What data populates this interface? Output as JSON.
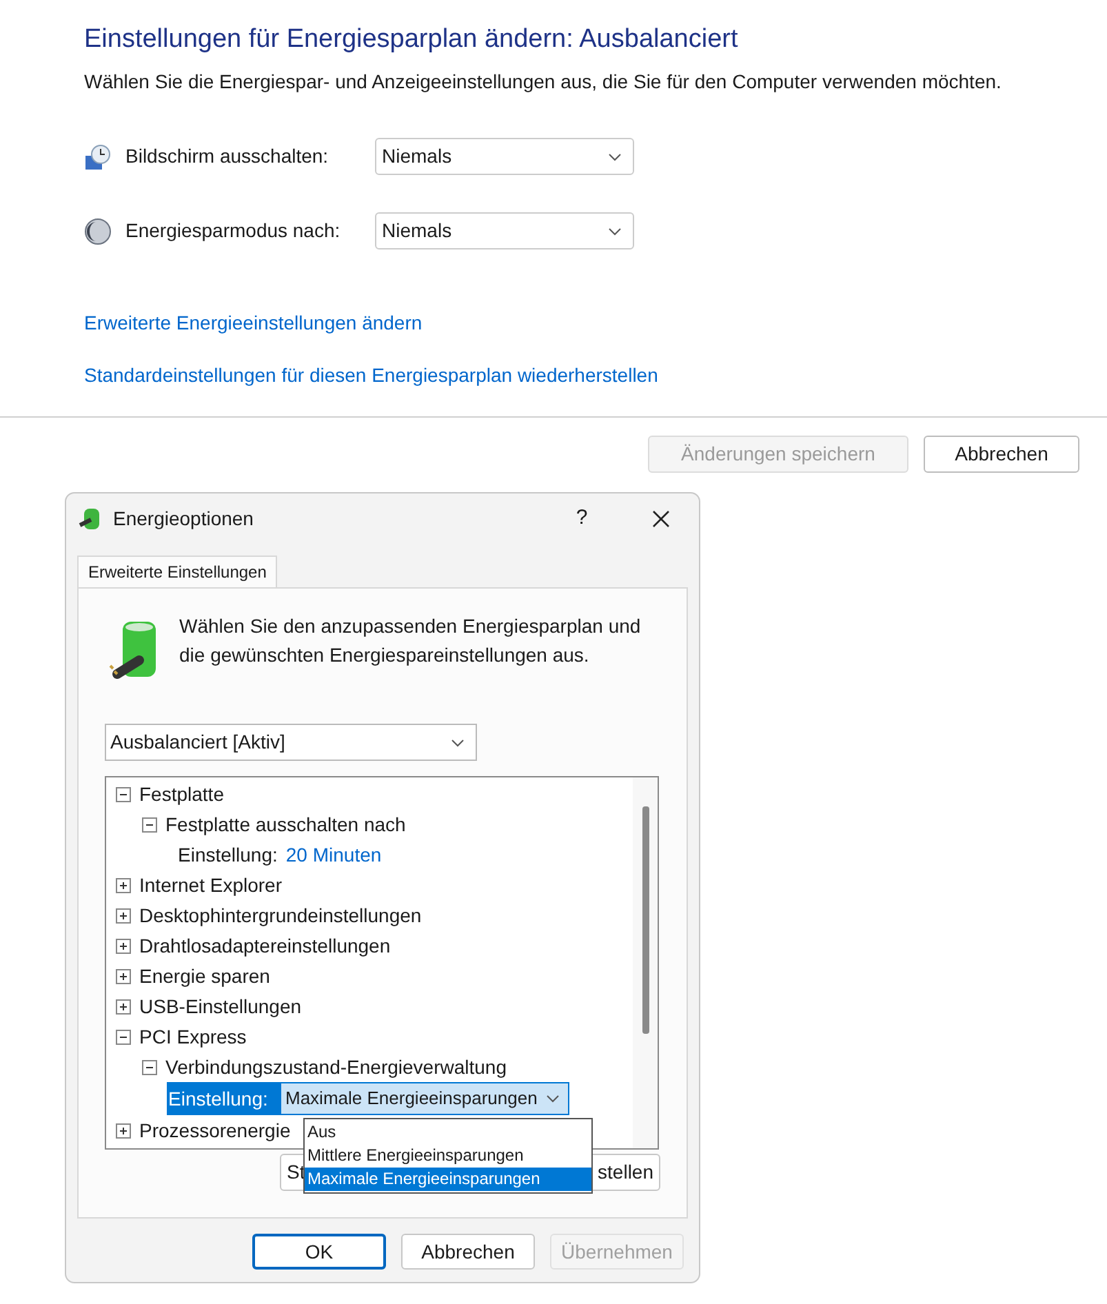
{
  "page": {
    "title": "Einstellungen für Energiesparplan ändern: Ausbalanciert",
    "description": "Wählen Sie die Energiespar- und Anzeigeeinstellungen aus, die Sie für den Computer verwenden möchten.",
    "settings": [
      {
        "kind": "display",
        "label": "Bildschirm ausschalten:",
        "value": "Niemals"
      },
      {
        "kind": "sleep",
        "label": "Energiesparmodus nach:",
        "value": "Niemals"
      }
    ],
    "links": [
      "Erweiterte Energieeinstellungen ändern",
      "Standardeinstellungen für diesen Energiesparplan wiederherstellen"
    ],
    "buttons": [
      {
        "label": "Änderungen speichern",
        "disabled": true
      },
      {
        "label": "Abbrechen",
        "disabled": false
      }
    ]
  },
  "dialog": {
    "title": "Energieoptionen",
    "help": "?",
    "tabs": [
      {
        "label": "Erweiterte Einstellungen",
        "selected": true
      }
    ],
    "intro": "Wählen Sie den anzupassenden Energiesparplan und die gewünschten Energiespareinstellungen aus.",
    "plan": "Ausbalanciert [Aktiv]",
    "tree": [
      {
        "kind": "node",
        "label": "Festplatte",
        "expanded": true,
        "children": [
          {
            "kind": "node",
            "label": "Festplatte ausschalten nach",
            "expanded": true,
            "children": [
              {
                "kind": "setting",
                "label": "Einstellung:",
                "value": "20 Minuten",
                "selected": false
              }
            ]
          }
        ]
      },
      {
        "kind": "node",
        "label": "Internet Explorer",
        "expanded": false
      },
      {
        "kind": "node",
        "label": "Desktophintergrundeinstellungen",
        "expanded": false
      },
      {
        "kind": "node",
        "label": "Drahtlosadaptereinstellungen",
        "expanded": false
      },
      {
        "kind": "node",
        "label": "Energie sparen",
        "expanded": false
      },
      {
        "kind": "node",
        "label": "USB-Einstellungen",
        "expanded": false
      },
      {
        "kind": "node",
        "label": "PCI Express",
        "expanded": true,
        "children": [
          {
            "kind": "node",
            "label": "Verbindungszustand-Energieverwaltung",
            "expanded": true,
            "children": [
              {
                "kind": "combo",
                "label": "Einstellung:",
                "value": "Maximale Energieeinsparungen",
                "selected": true
              }
            ]
          }
        ]
      },
      {
        "kind": "node",
        "label": "Prozessorenergie",
        "expanded": false
      }
    ],
    "options": [
      {
        "label": "Aus",
        "selected": false
      },
      {
        "label": "Mittlere Energieeinsparungen",
        "selected": false
      },
      {
        "label": "Maximale Energieeinsparungen",
        "selected": true
      }
    ],
    "restore_button": {
      "label_start": "St",
      "label_end": "stellen"
    },
    "buttons": [
      {
        "label": "OK",
        "kind": "default",
        "disabled": false
      },
      {
        "label": "Abbrechen",
        "kind": "normal",
        "disabled": false
      },
      {
        "label": "Übernehmen",
        "kind": "normal",
        "disabled": true
      }
    ]
  }
}
